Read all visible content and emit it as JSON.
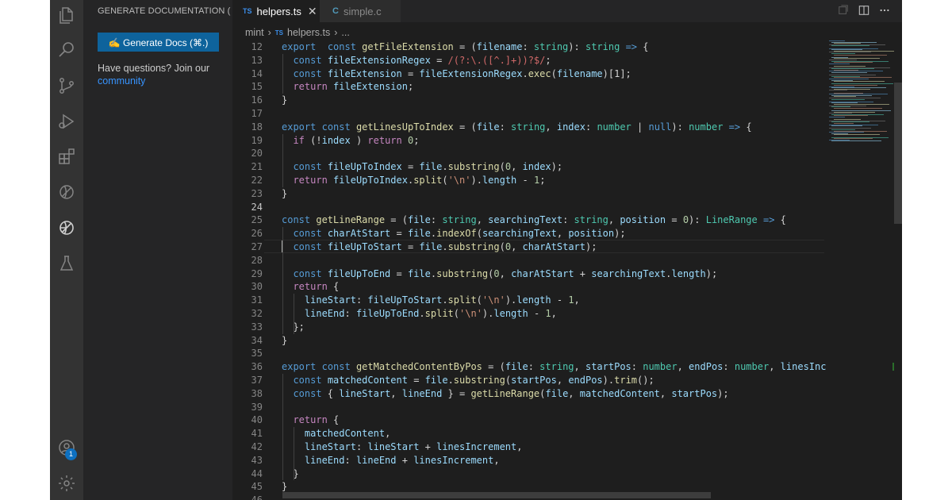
{
  "activity_bar": {
    "icons": [
      "explorer-icon",
      "search-icon",
      "source-control-icon",
      "run-debug-icon",
      "extensions-icon",
      "remote-icon",
      "mintlify-icon",
      "testing-icon",
      "account-icon",
      "settings-gear-icon"
    ],
    "account_badge": "1"
  },
  "sidebar": {
    "title": "GENERATE DOCUMENTATION (...",
    "generate_button": "✍ Generate Docs (⌘.)",
    "question_text": "Have questions? Join our",
    "community_link": "community"
  },
  "tabs": [
    {
      "icon_text": "TS",
      "label": "helpers.ts",
      "active": true
    },
    {
      "icon_text": "C",
      "label": "simple.c",
      "active": false
    }
  ],
  "breadcrumb": {
    "folder": "mint",
    "file_icon": "TS",
    "file": "helpers.ts",
    "more": "..."
  },
  "editor": {
    "current_line": 24,
    "lines": [
      {
        "n": "12",
        "tokens": [
          [
            "k",
            "export"
          ],
          [
            "",
            "  "
          ],
          [
            "k",
            "const"
          ],
          [
            "",
            " "
          ],
          [
            "f",
            "getFileExtension"
          ],
          [
            "",
            " = ("
          ],
          [
            "v",
            "filename"
          ],
          [
            "",
            ": "
          ],
          [
            "t",
            "string"
          ],
          [
            "",
            "): "
          ],
          [
            "t",
            "string"
          ],
          [
            "",
            " "
          ],
          [
            "k",
            "=>"
          ],
          [
            "",
            " {"
          ]
        ]
      },
      {
        "n": "13",
        "tokens": [
          [
            "",
            "  "
          ],
          [
            "k",
            "const"
          ],
          [
            "",
            " "
          ],
          [
            "v",
            "fileExtensionRegex"
          ],
          [
            "",
            " = "
          ],
          [
            "r",
            "/(?:\\.([^.]+))?$/"
          ],
          [
            "",
            ";"
          ]
        ]
      },
      {
        "n": "14",
        "tokens": [
          [
            "",
            "  "
          ],
          [
            "k",
            "const"
          ],
          [
            "",
            " "
          ],
          [
            "v",
            "fileExtension"
          ],
          [
            "",
            " = "
          ],
          [
            "v",
            "fileExtensionRegex"
          ],
          [
            "",
            "."
          ],
          [
            "f",
            "exec"
          ],
          [
            "",
            "("
          ],
          [
            "v",
            "filename"
          ],
          [
            "",
            ")[1];"
          ]
        ]
      },
      {
        "n": "15",
        "tokens": [
          [
            "",
            "  "
          ],
          [
            "c",
            "return"
          ],
          [
            "",
            " "
          ],
          [
            "v",
            "fileExtension"
          ],
          [
            "",
            ";"
          ]
        ]
      },
      {
        "n": "16",
        "tokens": [
          [
            "",
            "}"
          ]
        ]
      },
      {
        "n": "17",
        "tokens": []
      },
      {
        "n": "18",
        "tokens": [
          [
            "k",
            "export"
          ],
          [
            "",
            " "
          ],
          [
            "k",
            "const"
          ],
          [
            "",
            " "
          ],
          [
            "f",
            "getLinesUpToIndex"
          ],
          [
            "",
            " = ("
          ],
          [
            "v",
            "file"
          ],
          [
            "",
            ": "
          ],
          [
            "t",
            "string"
          ],
          [
            "",
            ", "
          ],
          [
            "v",
            "index"
          ],
          [
            "",
            ": "
          ],
          [
            "t",
            "number"
          ],
          [
            "",
            " | "
          ],
          [
            "k",
            "null"
          ],
          [
            "",
            "): "
          ],
          [
            "t",
            "number"
          ],
          [
            "",
            " "
          ],
          [
            "k",
            "=>"
          ],
          [
            "",
            " {"
          ]
        ]
      },
      {
        "n": "19",
        "tokens": [
          [
            "",
            "  "
          ],
          [
            "c",
            "if"
          ],
          [
            "",
            " (!"
          ],
          [
            "v",
            "index"
          ],
          [
            "",
            " ) "
          ],
          [
            "c",
            "return"
          ],
          [
            "",
            " "
          ],
          [
            "n",
            "0"
          ],
          [
            "",
            ";"
          ]
        ]
      },
      {
        "n": "20",
        "tokens": []
      },
      {
        "n": "21",
        "tokens": [
          [
            "",
            "  "
          ],
          [
            "k",
            "const"
          ],
          [
            "",
            " "
          ],
          [
            "v",
            "fileUpToIndex"
          ],
          [
            "",
            " = "
          ],
          [
            "v",
            "file"
          ],
          [
            "",
            "."
          ],
          [
            "f",
            "substring"
          ],
          [
            "",
            "("
          ],
          [
            "n",
            "0"
          ],
          [
            "",
            ", "
          ],
          [
            "v",
            "index"
          ],
          [
            "",
            ");"
          ]
        ]
      },
      {
        "n": "22",
        "tokens": [
          [
            "",
            "  "
          ],
          [
            "c",
            "return"
          ],
          [
            "",
            " "
          ],
          [
            "v",
            "fileUpToIndex"
          ],
          [
            "",
            "."
          ],
          [
            "f",
            "split"
          ],
          [
            "",
            "("
          ],
          [
            "s",
            "'\\n'"
          ],
          [
            "",
            ")."
          ],
          [
            "v",
            "length"
          ],
          [
            "",
            " - "
          ],
          [
            "n",
            "1"
          ],
          [
            "",
            ";"
          ]
        ]
      },
      {
        "n": "23",
        "tokens": [
          [
            "",
            "}"
          ]
        ]
      },
      {
        "n": "24",
        "tokens": []
      },
      {
        "n": "25",
        "tokens": [
          [
            "k",
            "const"
          ],
          [
            "",
            " "
          ],
          [
            "f",
            "getLineRange"
          ],
          [
            "",
            " = ("
          ],
          [
            "v",
            "file"
          ],
          [
            "",
            ": "
          ],
          [
            "t",
            "string"
          ],
          [
            "",
            ", "
          ],
          [
            "v",
            "searchingText"
          ],
          [
            "",
            ": "
          ],
          [
            "t",
            "string"
          ],
          [
            "",
            ", "
          ],
          [
            "v",
            "position"
          ],
          [
            "",
            " = "
          ],
          [
            "n",
            "0"
          ],
          [
            "",
            "): "
          ],
          [
            "t",
            "LineRange"
          ],
          [
            "",
            " "
          ],
          [
            "k",
            "=>"
          ],
          [
            "",
            " {"
          ]
        ]
      },
      {
        "n": "26",
        "tokens": [
          [
            "",
            "  "
          ],
          [
            "k",
            "const"
          ],
          [
            "",
            " "
          ],
          [
            "v",
            "charAtStart"
          ],
          [
            "",
            " = "
          ],
          [
            "v",
            "file"
          ],
          [
            "",
            "."
          ],
          [
            "f",
            "indexOf"
          ],
          [
            "",
            "("
          ],
          [
            "v",
            "searchingText"
          ],
          [
            "",
            ", "
          ],
          [
            "v",
            "position"
          ],
          [
            "",
            ");"
          ]
        ]
      },
      {
        "n": "27",
        "tokens": [
          [
            "",
            "  "
          ],
          [
            "k",
            "const"
          ],
          [
            "",
            " "
          ],
          [
            "v",
            "fileUpToStart"
          ],
          [
            "",
            " = "
          ],
          [
            "v",
            "file"
          ],
          [
            "",
            "."
          ],
          [
            "f",
            "substring"
          ],
          [
            "",
            "("
          ],
          [
            "n",
            "0"
          ],
          [
            "",
            ", "
          ],
          [
            "v",
            "charAtStart"
          ],
          [
            "",
            ");"
          ]
        ]
      },
      {
        "n": "28",
        "tokens": []
      },
      {
        "n": "29",
        "tokens": [
          [
            "",
            "  "
          ],
          [
            "k",
            "const"
          ],
          [
            "",
            " "
          ],
          [
            "v",
            "fileUpToEnd"
          ],
          [
            "",
            " = "
          ],
          [
            "v",
            "file"
          ],
          [
            "",
            "."
          ],
          [
            "f",
            "substring"
          ],
          [
            "",
            "("
          ],
          [
            "n",
            "0"
          ],
          [
            "",
            ", "
          ],
          [
            "v",
            "charAtStart"
          ],
          [
            "",
            " + "
          ],
          [
            "v",
            "searchingText"
          ],
          [
            "",
            "."
          ],
          [
            "v",
            "length"
          ],
          [
            "",
            ");"
          ]
        ]
      },
      {
        "n": "30",
        "tokens": [
          [
            "",
            "  "
          ],
          [
            "c",
            "return"
          ],
          [
            "",
            " {"
          ]
        ]
      },
      {
        "n": "31",
        "tokens": [
          [
            "",
            "    "
          ],
          [
            "v",
            "lineStart"
          ],
          [
            "",
            ": "
          ],
          [
            "v",
            "fileUpToStart"
          ],
          [
            "",
            "."
          ],
          [
            "f",
            "split"
          ],
          [
            "",
            "("
          ],
          [
            "s",
            "'\\n'"
          ],
          [
            "",
            ")."
          ],
          [
            "v",
            "length"
          ],
          [
            "",
            " - "
          ],
          [
            "n",
            "1"
          ],
          [
            "",
            ","
          ]
        ]
      },
      {
        "n": "32",
        "tokens": [
          [
            "",
            "    "
          ],
          [
            "v",
            "lineEnd"
          ],
          [
            "",
            ": "
          ],
          [
            "v",
            "fileUpToEnd"
          ],
          [
            "",
            "."
          ],
          [
            "f",
            "split"
          ],
          [
            "",
            "("
          ],
          [
            "s",
            "'\\n'"
          ],
          [
            "",
            ")."
          ],
          [
            "v",
            "length"
          ],
          [
            "",
            " - "
          ],
          [
            "n",
            "1"
          ],
          [
            "",
            ","
          ]
        ]
      },
      {
        "n": "33",
        "tokens": [
          [
            "",
            "  };"
          ]
        ]
      },
      {
        "n": "34",
        "tokens": [
          [
            "",
            "}"
          ]
        ]
      },
      {
        "n": "35",
        "tokens": []
      },
      {
        "n": "36",
        "tokens": [
          [
            "k",
            "export"
          ],
          [
            "",
            " "
          ],
          [
            "k",
            "const"
          ],
          [
            "",
            " "
          ],
          [
            "f",
            "getMatchedContentByPos"
          ],
          [
            "",
            " = ("
          ],
          [
            "v",
            "file"
          ],
          [
            "",
            ": "
          ],
          [
            "t",
            "string"
          ],
          [
            "",
            ", "
          ],
          [
            "v",
            "startPos"
          ],
          [
            "",
            ": "
          ],
          [
            "t",
            "number"
          ],
          [
            "",
            ", "
          ],
          [
            "v",
            "endPos"
          ],
          [
            "",
            ": "
          ],
          [
            "t",
            "number"
          ],
          [
            "",
            ", "
          ],
          [
            "v",
            "linesIncrement"
          ]
        ]
      },
      {
        "n": "37",
        "tokens": [
          [
            "",
            "  "
          ],
          [
            "k",
            "const"
          ],
          [
            "",
            " "
          ],
          [
            "v",
            "matchedContent"
          ],
          [
            "",
            " = "
          ],
          [
            "v",
            "file"
          ],
          [
            "",
            "."
          ],
          [
            "f",
            "substring"
          ],
          [
            "",
            "("
          ],
          [
            "v",
            "startPos"
          ],
          [
            "",
            ", "
          ],
          [
            "v",
            "endPos"
          ],
          [
            "",
            ")."
          ],
          [
            "f",
            "trim"
          ],
          [
            "",
            "();"
          ]
        ]
      },
      {
        "n": "38",
        "tokens": [
          [
            "",
            "  "
          ],
          [
            "k",
            "const"
          ],
          [
            "",
            " { "
          ],
          [
            "v",
            "lineStart"
          ],
          [
            "",
            ", "
          ],
          [
            "v",
            "lineEnd"
          ],
          [
            "",
            " } = "
          ],
          [
            "f",
            "getLineRange"
          ],
          [
            "",
            "("
          ],
          [
            "v",
            "file"
          ],
          [
            "",
            ", "
          ],
          [
            "v",
            "matchedContent"
          ],
          [
            "",
            ", "
          ],
          [
            "v",
            "startPos"
          ],
          [
            "",
            ");"
          ]
        ]
      },
      {
        "n": "39",
        "tokens": []
      },
      {
        "n": "40",
        "tokens": [
          [
            "",
            "  "
          ],
          [
            "c",
            "return"
          ],
          [
            "",
            " {"
          ]
        ]
      },
      {
        "n": "41",
        "tokens": [
          [
            "",
            "    "
          ],
          [
            "v",
            "matchedContent"
          ],
          [
            "",
            ","
          ]
        ]
      },
      {
        "n": "42",
        "tokens": [
          [
            "",
            "    "
          ],
          [
            "v",
            "lineStart"
          ],
          [
            "",
            ": "
          ],
          [
            "v",
            "lineStart"
          ],
          [
            "",
            " + "
          ],
          [
            "v",
            "linesIncrement"
          ],
          [
            "",
            ","
          ]
        ]
      },
      {
        "n": "43",
        "tokens": [
          [
            "",
            "    "
          ],
          [
            "v",
            "lineEnd"
          ],
          [
            "",
            ": "
          ],
          [
            "v",
            "lineEnd"
          ],
          [
            "",
            " + "
          ],
          [
            "v",
            "linesIncrement"
          ],
          [
            "",
            ","
          ]
        ]
      },
      {
        "n": "44",
        "tokens": [
          [
            "",
            "  }"
          ]
        ]
      },
      {
        "n": "45",
        "tokens": [
          [
            "",
            "}"
          ]
        ]
      },
      {
        "n": "46",
        "tokens": []
      }
    ]
  },
  "colors": {
    "background": "#1e1e1e",
    "sidebar": "#252526",
    "activity_bar": "#333333",
    "button": "#0e639c",
    "link": "#3794ff"
  }
}
